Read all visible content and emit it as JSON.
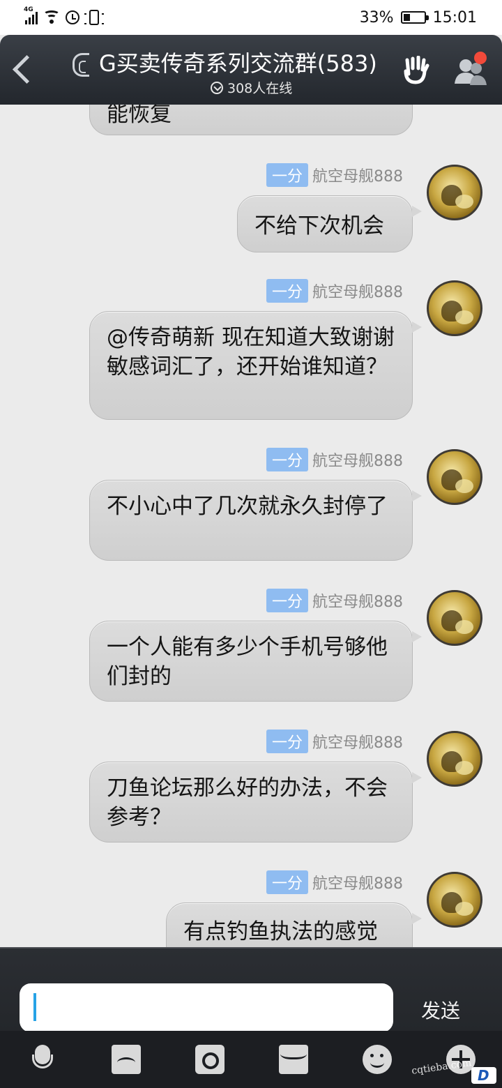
{
  "status_bar": {
    "network": "4G",
    "battery": "33%",
    "battery_level": 0.33,
    "time": "15:01"
  },
  "header": {
    "title": "G买卖传奇系列交流群(583)",
    "online": "308人在线"
  },
  "messages": [
    {
      "text": "能恢复"
    },
    {
      "badge": "一分",
      "name": "航空母舰888",
      "text": "不给下次机会"
    },
    {
      "badge": "一分",
      "name": "航空母舰888",
      "text": "@传奇萌新 现在知道大致谢谢敏感词汇了，还开始谁知道？"
    },
    {
      "badge": "一分",
      "name": "航空母舰888",
      "text": "不小心中了几次就永久封停了"
    },
    {
      "badge": "一分",
      "name": "航空母舰888",
      "text": "一个人能有多少个手机号够他们封的"
    },
    {
      "badge": "一分",
      "name": "航空母舰888",
      "text": "刀鱼论坛那么好的办法，不会参考？"
    },
    {
      "badge": "一分",
      "name": "航空母舰888",
      "text": "有点钓鱼执法的感觉"
    }
  ],
  "input": {
    "value": "",
    "send_label": "发送"
  },
  "toolbar": {
    "icons": [
      "microphone-icon",
      "image-icon",
      "camera-icon",
      "envelope-icon",
      "emoji-icon",
      "plus-icon"
    ]
  },
  "watermark": {
    "text": "cqtieba.com"
  },
  "colors": {
    "accent": "#27a3e6",
    "badge": "#8fbcf1",
    "header": "#2d3137",
    "notification": "#f24a3a"
  }
}
